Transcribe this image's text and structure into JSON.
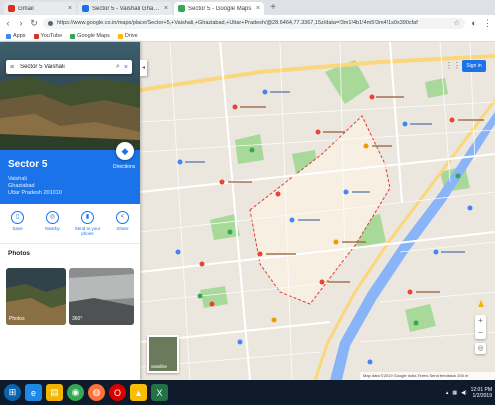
{
  "browser": {
    "tabs": [
      {
        "title": "Gmail",
        "color": "#d93025",
        "active": false
      },
      {
        "title": "Sector 5 - Vaishali Ghaziabad",
        "color": "#1a73e8",
        "active": false
      },
      {
        "title": "Sector 5 - Google Maps",
        "color": "#34a853",
        "active": true
      }
    ],
    "new_tab_glyph": "+",
    "url": "https://www.google.co.in/maps/place/Sector+5,+Vaishali,+Ghaziabad,+Uttar+Pradesh/@28.6464,77.3367,15z/data=!3m1!4b1!4m5!3m4!1s0x390cfaf",
    "bookmarks": [
      {
        "label": "Apps",
        "color": "#4285f4"
      },
      {
        "label": "YouTube",
        "color": "#d93025"
      },
      {
        "label": "Google Maps",
        "color": "#34a853"
      },
      {
        "label": "Drive",
        "color": "#fbbc04"
      }
    ]
  },
  "panel": {
    "search_value": "Sector 5 Vaishali",
    "place_name": "Sector 5",
    "place_lines": [
      "Vaishali",
      "Ghaziabad",
      "Uttar Pradesh 201010"
    ],
    "directions_label": "Directions",
    "actions": [
      {
        "label": "Save",
        "icon": "bookmark-icon",
        "glyph": "▯"
      },
      {
        "label": "Nearby",
        "icon": "nearby-icon",
        "glyph": "◎"
      },
      {
        "label": "Send to your phone",
        "icon": "phone-icon",
        "glyph": "▮"
      },
      {
        "label": "Share",
        "icon": "share-icon",
        "glyph": "<"
      }
    ],
    "photos_heading": "Photos",
    "photos": [
      {
        "label": "Photos"
      },
      {
        "label": "360°"
      }
    ]
  },
  "map": {
    "signin_label": "Sign in",
    "satellite_label": "Satellite",
    "attribution": "Map data ©2019 Google  India  Terms  Send feedback  200 m",
    "zoom_in": "+",
    "zoom_out": "−",
    "colors": {
      "background": "#ebe7df",
      "park": "#a8d89a",
      "water": "#8ab4f8",
      "highway": "#fbd77b",
      "road": "#ffffff",
      "boundary": "#e53935",
      "pin_red": "#ea4335",
      "pin_blue": "#4285f4",
      "pin_green": "#34a853",
      "pin_orange": "#f29900"
    }
  },
  "taskbar": {
    "time": "12:01 PM",
    "date": "1/2/2019",
    "apps": [
      {
        "name": "start-icon",
        "color": "#0a64ad"
      },
      {
        "name": "ie-icon",
        "color": "#1e88e5"
      },
      {
        "name": "explorer-icon",
        "color": "#f2b600"
      },
      {
        "name": "chrome-icon",
        "color": "#34a853"
      },
      {
        "name": "firefox-icon",
        "color": "#ff7139"
      },
      {
        "name": "opera-icon",
        "color": "#d60000"
      },
      {
        "name": "vlc-icon",
        "color": "#fbbc04"
      },
      {
        "name": "excel-icon",
        "color": "#217346"
      }
    ]
  }
}
